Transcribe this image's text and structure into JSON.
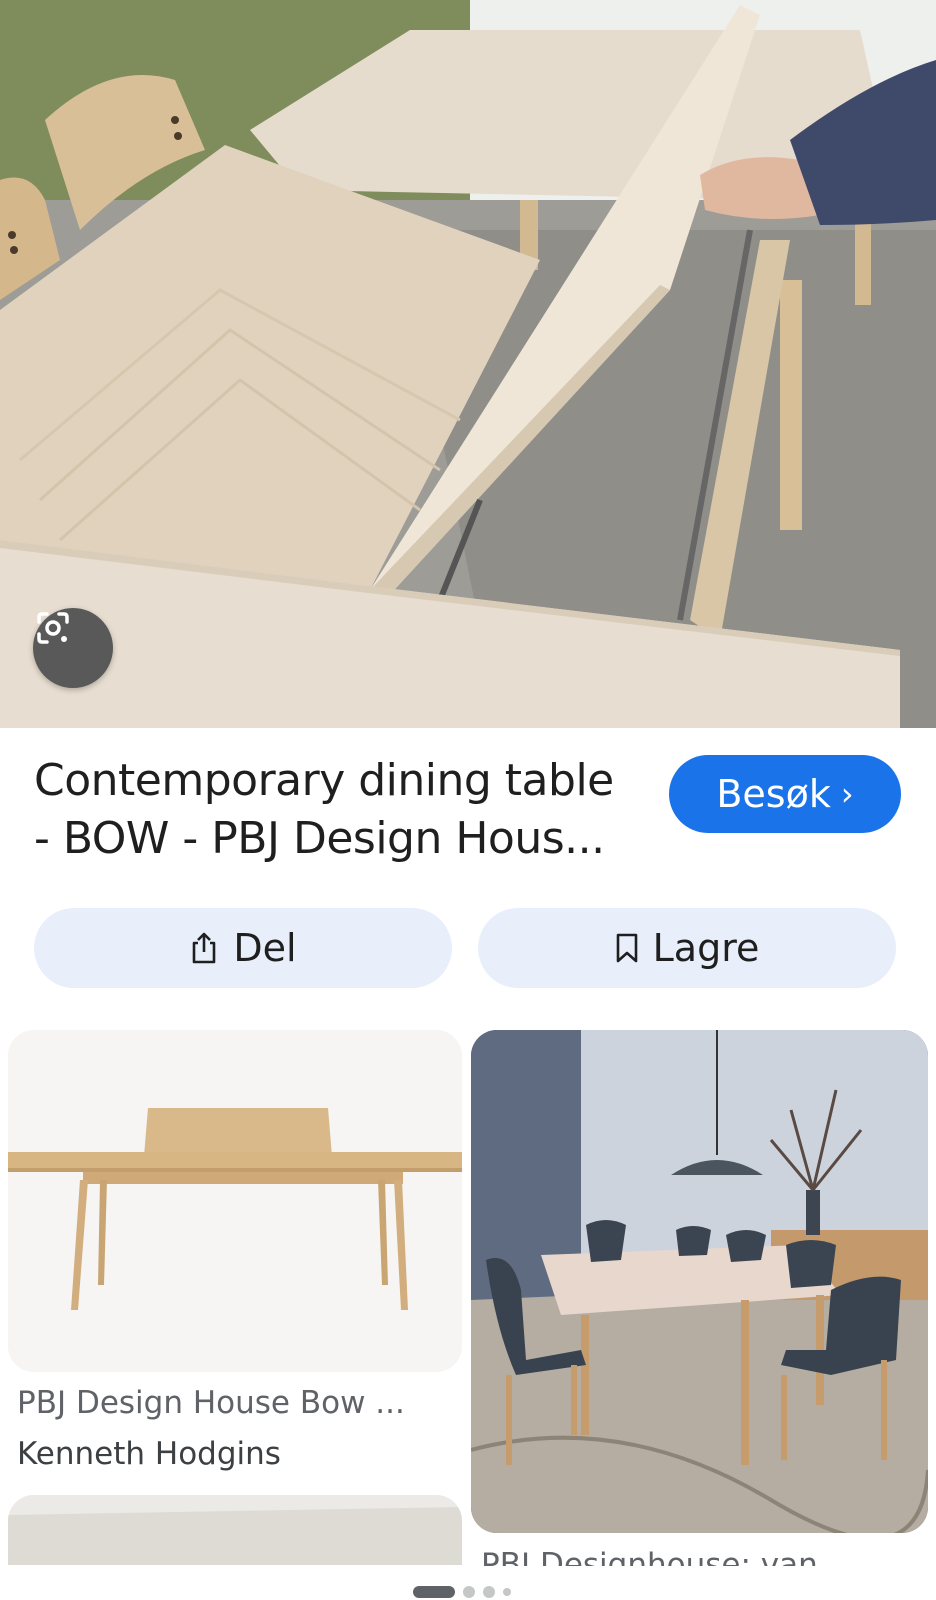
{
  "hero": {
    "image_alt": "Extendable oak dining table with leaf being lifted"
  },
  "lens": {
    "icon": "google-lens-icon"
  },
  "result": {
    "title_line1": "Contemporary dining table",
    "title_line2": "- BOW - PBJ Design Hous...",
    "visit_label": "Besøk",
    "visit_chevron": "›"
  },
  "actions": {
    "share_label": "Del",
    "save_label": "Lagre"
  },
  "related": [
    {
      "title": "PBJ Design House Bow ...",
      "source": "Kenneth Hodgins"
    },
    {
      "title": "PBJ Designhouse: van"
    }
  ],
  "pager": {
    "count": 4,
    "active": 0
  },
  "colors": {
    "accent": "#1a73e8",
    "action_bg": "#e8effb",
    "lens_bg": "#595959"
  }
}
